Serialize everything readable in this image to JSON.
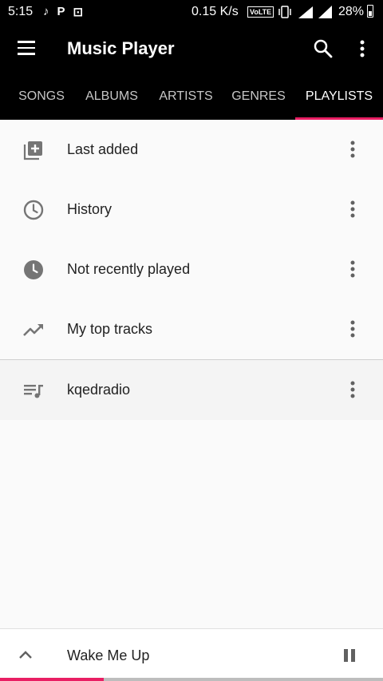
{
  "status_bar": {
    "time": "5:15",
    "speed": "0.15 K/s",
    "volte": "VoLTE",
    "battery": "28%"
  },
  "app_bar": {
    "title": "Music Player",
    "icons": [
      "menu-icon",
      "search-icon",
      "more-vert-icon"
    ]
  },
  "tabs": [
    {
      "label": "SONGS"
    },
    {
      "label": "ALBUMS"
    },
    {
      "label": "ARTISTS"
    },
    {
      "label": "GENRES"
    },
    {
      "label": "PLAYLISTS"
    }
  ],
  "active_tab": "PLAYLISTS",
  "playlists": {
    "smart": [
      {
        "label": "Last added",
        "icon": "playlist-add-icon"
      },
      {
        "label": "History",
        "icon": "history-clock-icon"
      },
      {
        "label": "Not recently played",
        "icon": "clock-filled-icon"
      },
      {
        "label": "My top tracks",
        "icon": "trending-up-icon"
      }
    ],
    "user": [
      {
        "label": "kqedradio",
        "icon": "queue-music-icon"
      }
    ]
  },
  "now_playing": {
    "song": "Wake Me Up",
    "progress": 0.27
  },
  "colors": {
    "accent": "#e91e63",
    "toolbar": "#000000",
    "background": "#fafafa"
  }
}
